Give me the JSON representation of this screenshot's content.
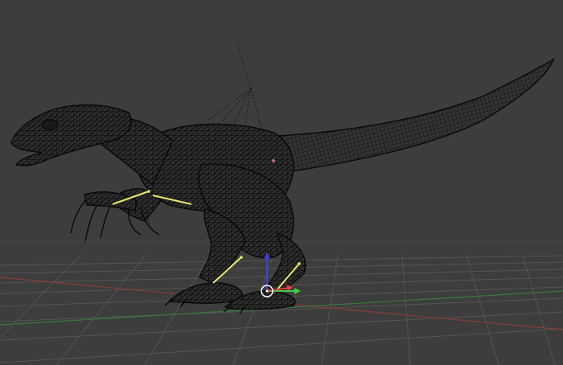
{
  "viewport": {
    "view": "3d-viewport",
    "display_mode": "wireframe",
    "background": "#3d3d3d"
  },
  "grid": {
    "line_color": "#5a5a5a",
    "x_axis_color": "#8a3b3b",
    "y_axis_color": "#3b7a3b"
  },
  "model": {
    "subject": "raptor-dinosaur-mesh",
    "wire_color": "#0a0a0a"
  },
  "armature": {
    "bone_color": "#e8e86a",
    "selected_joint_color": "#ffffff"
  },
  "gizmo": {
    "x_color": "#e04040",
    "y_color": "#40d040",
    "z_color": "#4040e0"
  }
}
